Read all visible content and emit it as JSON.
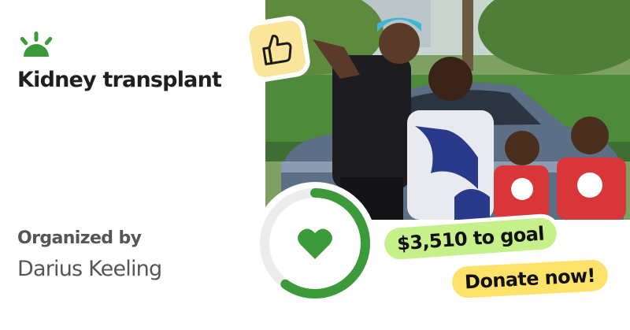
{
  "campaign": {
    "title": "Kidney transplant",
    "organizer_label": "Organized by",
    "organizer_name": "Darius Keeling"
  },
  "progress": {
    "goal_text": "$3,510 to goal",
    "fraction": 0.6
  },
  "actions": {
    "donate_label": "Donate now!"
  },
  "icons": {
    "logo": "gofundme-sprout-icon",
    "thumbs": "thumbs-up-icon",
    "heart": "heart-icon"
  },
  "colors": {
    "brand_green": "#3d9a3a",
    "goal_pill": "#c6f08a",
    "donate_pill": "#ffe26a",
    "thumbs_badge": "#fbe59a",
    "ring_track": "#ececec"
  }
}
